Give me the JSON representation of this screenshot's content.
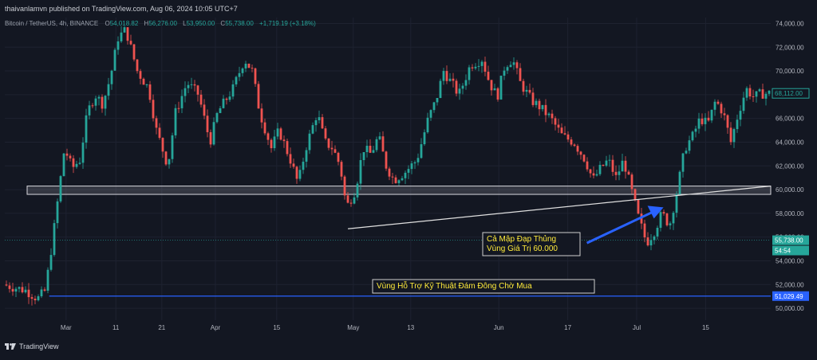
{
  "header": {
    "publisher": "thaivanlamvn published on TradingView.com, Aug 06, 2024 10:05 UTC+7"
  },
  "symbol_line": {
    "symbol": "Bitcoin / TetherUS, 4h, BINANCE",
    "o_label": "O",
    "o_value": "54,018.82",
    "h_label": "H",
    "h_value": "56,276.00",
    "l_label": "L",
    "l_value": "53,950.00",
    "c_label": "C",
    "c_value": "55,738.00",
    "change": "+1,719.19 (+3.18%)"
  },
  "footer": {
    "brand": "TradingView"
  },
  "colors": {
    "background": "#131722",
    "up": "#26a69a",
    "down": "#ef5350",
    "grid": "#1e2230",
    "support_line": "#2962ff",
    "annotation_text": "#ffeb3b",
    "arrow": "#2962ff"
  },
  "chart_data": {
    "type": "candlestick",
    "title": "Bitcoin / TetherUS, 4h, BINANCE",
    "xlabel": "",
    "ylabel": "",
    "ylim": [
      49000,
      74500
    ],
    "grid": true,
    "y_ticks": [
      "74,000.00",
      "72,000.00",
      "70,000.00",
      "68,000.00",
      "66,000.00",
      "64,000.00",
      "62,000.00",
      "60,000.00",
      "58,000.00",
      "56,000.00",
      "54,000.00",
      "52,000.00",
      "50,000.00"
    ],
    "x_ticks": [
      "Mar",
      "11",
      "21",
      "Apr",
      "15",
      "May",
      "13",
      "Jun",
      "17",
      "Jul",
      "15"
    ],
    "price_path": [
      [
        0,
        52000
      ],
      [
        0.03,
        51500
      ],
      [
        0.045,
        50800
      ],
      [
        0.055,
        51500
      ],
      [
        0.065,
        56000
      ],
      [
        0.08,
        63500
      ],
      [
        0.09,
        61800
      ],
      [
        0.1,
        62500
      ],
      [
        0.11,
        66500
      ],
      [
        0.12,
        68000
      ],
      [
        0.13,
        67200
      ],
      [
        0.14,
        69500
      ],
      [
        0.15,
        72800
      ],
      [
        0.16,
        73500
      ],
      [
        0.175,
        70000
      ],
      [
        0.19,
        68500
      ],
      [
        0.2,
        65000
      ],
      [
        0.215,
        62000
      ],
      [
        0.225,
        66500
      ],
      [
        0.24,
        69000
      ],
      [
        0.255,
        68000
      ],
      [
        0.27,
        64000
      ],
      [
        0.28,
        66500
      ],
      [
        0.29,
        67500
      ],
      [
        0.3,
        68500
      ],
      [
        0.315,
        71000
      ],
      [
        0.325,
        70000
      ],
      [
        0.335,
        66500
      ],
      [
        0.35,
        63500
      ],
      [
        0.36,
        65000
      ],
      [
        0.375,
        62500
      ],
      [
        0.385,
        60500
      ],
      [
        0.395,
        63500
      ],
      [
        0.41,
        66500
      ],
      [
        0.42,
        64000
      ],
      [
        0.43,
        63500
      ],
      [
        0.44,
        62000
      ],
      [
        0.448,
        58500
      ],
      [
        0.46,
        60000
      ],
      [
        0.47,
        63500
      ],
      [
        0.48,
        63000
      ],
      [
        0.49,
        64500
      ],
      [
        0.5,
        62000
      ],
      [
        0.51,
        60800
      ],
      [
        0.525,
        61500
      ],
      [
        0.54,
        62500
      ],
      [
        0.555,
        66000
      ],
      [
        0.565,
        67500
      ],
      [
        0.575,
        70000
      ],
      [
        0.585,
        69000
      ],
      [
        0.595,
        68000
      ],
      [
        0.61,
        70500
      ],
      [
        0.625,
        71000
      ],
      [
        0.635,
        69000
      ],
      [
        0.645,
        67800
      ],
      [
        0.655,
        70500
      ],
      [
        0.665,
        71000
      ],
      [
        0.675,
        69000
      ],
      [
        0.69,
        67500
      ],
      [
        0.7,
        67000
      ],
      [
        0.715,
        66000
      ],
      [
        0.73,
        64500
      ],
      [
        0.745,
        64000
      ],
      [
        0.76,
        62500
      ],
      [
        0.77,
        60800
      ],
      [
        0.78,
        61800
      ],
      [
        0.79,
        62500
      ],
      [
        0.8,
        61000
      ],
      [
        0.81,
        62500
      ],
      [
        0.82,
        60000
      ],
      [
        0.83,
        57500
      ],
      [
        0.84,
        55500
      ],
      [
        0.85,
        56500
      ],
      [
        0.86,
        58000
      ],
      [
        0.87,
        57000
      ],
      [
        0.88,
        60000
      ],
      [
        0.89,
        63500
      ],
      [
        0.9,
        64500
      ],
      [
        0.91,
        66000
      ],
      [
        0.92,
        65500
      ],
      [
        0.93,
        67500
      ],
      [
        0.94,
        66500
      ],
      [
        0.95,
        64000
      ],
      [
        0.96,
        66500
      ],
      [
        0.97,
        68500
      ],
      [
        0.98,
        67800
      ],
      [
        0.99,
        68100
      ]
    ],
    "zones": [
      {
        "name": "60k value zone",
        "low": 59600,
        "high": 60300
      }
    ],
    "trendline": {
      "from": {
        "x": 0.448,
        "y": 56700
      },
      "to": {
        "x": 1.0,
        "y": 60300
      }
    },
    "support_level": 51029.49,
    "price_tags": [
      {
        "value": "68,112.00",
        "price": 68112,
        "style": "outline"
      },
      {
        "value": "55,738.00",
        "price": 55738,
        "style": "filled"
      },
      {
        "value": "54:54",
        "price": 54870,
        "style": "filled"
      },
      {
        "value": "51,029.49",
        "price": 51029.49,
        "style": "blue"
      }
    ],
    "annotations": [
      {
        "lines": [
          "Cả Mập Đạp Thủng",
          "Vùng Giá Trị 60.000"
        ],
        "anchor_price": 55700,
        "anchor_x": 0.62
      },
      {
        "lines": [
          "Vùng Hỗ Trợ Kỹ Thuật Đám Đông Chờ Mua"
        ],
        "anchor_price": 51800,
        "anchor_x": 0.477
      }
    ],
    "arrow": {
      "from": {
        "x": 0.76,
        "y": 55500
      },
      "to": {
        "x": 0.86,
        "y": 58500
      }
    }
  }
}
